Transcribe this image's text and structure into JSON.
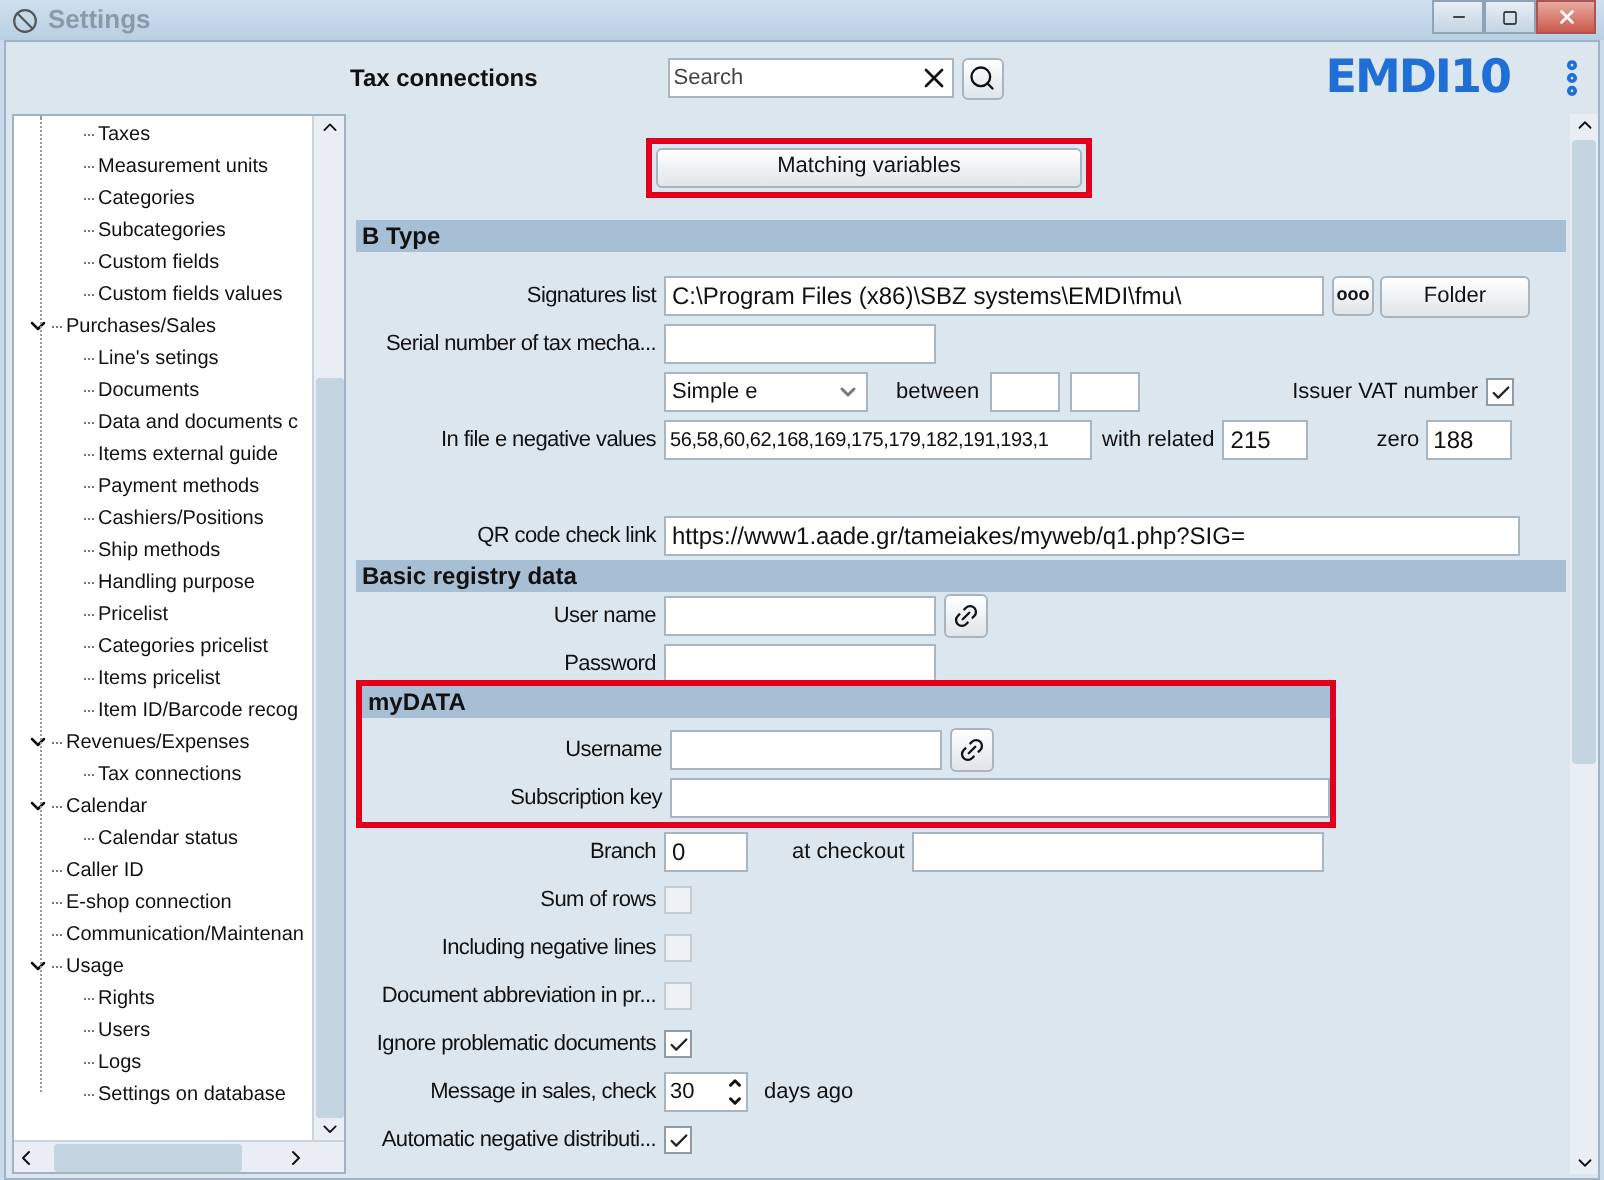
{
  "window": {
    "title": "Settings"
  },
  "header": {
    "title": "Tax connections",
    "search": {
      "placeholder": "Search"
    },
    "logo": "EMDI10"
  },
  "tree": [
    {
      "children": [
        {
          "label": "Taxes"
        },
        {
          "label": "Measurement units"
        },
        {
          "label": "Categories"
        },
        {
          "label": "Subcategories"
        },
        {
          "label": "Custom fields"
        },
        {
          "label": "Custom fields values"
        }
      ]
    },
    {
      "label": "Purchases/Sales",
      "expanded": true,
      "children": [
        {
          "label": "Line's setings"
        },
        {
          "label": "Documents"
        },
        {
          "label": "Data and documents c"
        },
        {
          "label": "Items external guide"
        },
        {
          "label": "Payment methods"
        },
        {
          "label": "Cashiers/Positions"
        },
        {
          "label": "Ship methods"
        },
        {
          "label": "Handling purpose"
        },
        {
          "label": "Pricelist"
        },
        {
          "label": "Categories pricelist"
        },
        {
          "label": "Items pricelist"
        },
        {
          "label": "Item ID/Barcode recog"
        }
      ]
    },
    {
      "label": "Revenues/Expenses",
      "expanded": true,
      "children": [
        {
          "label": "Tax connections"
        }
      ]
    },
    {
      "label": "Calendar",
      "expanded": true,
      "children": [
        {
          "label": "Calendar status"
        }
      ]
    },
    {
      "label": "Caller ID"
    },
    {
      "label": "E-shop connection"
    },
    {
      "label": "Communication/Maintenan"
    },
    {
      "label": "Usage",
      "expanded": true,
      "children": [
        {
          "label": "Rights"
        },
        {
          "label": "Users"
        },
        {
          "label": "Logs"
        },
        {
          "label": "Settings on database"
        }
      ]
    }
  ],
  "matching_button": {
    "label": "Matching variables",
    "highlighted": true
  },
  "b_type": {
    "title": "B Type",
    "signatures_list": {
      "label": "Signatures list",
      "value": "C:\\Program Files (x86)\\SBZ systems\\EMDI\\fmu\\",
      "browse": "ooo",
      "folder": "Folder"
    },
    "serial": {
      "label": "Serial number of tax mecha..."
    },
    "type_select": {
      "value": "Simple e",
      "between": "between"
    },
    "issuer_vat": {
      "label": "Issuer VAT number",
      "checked": true
    },
    "negative": {
      "label": "In file e negative values",
      "value": "56,58,60,62,168,169,175,179,182,191,193,1",
      "with_related_label": "with related",
      "with_related": "215",
      "zero_label": "zero",
      "zero": "188"
    },
    "qr": {
      "label": "QR code check link",
      "value": "https://www1.aade.gr/tameiakes/myweb/q1.php?SIG="
    }
  },
  "basic": {
    "title": "Basic registry data",
    "user_name": "User name",
    "password": "Password"
  },
  "mydata": {
    "title": "myDATA",
    "highlighted": true,
    "username": "Username",
    "subscription_key": "Subscription key"
  },
  "branch": {
    "label": "Branch",
    "value": "0",
    "at_checkout": "at checkout"
  },
  "options": [
    {
      "kind": "checkbox",
      "label": "Sum of rows",
      "checked": false
    },
    {
      "kind": "checkbox",
      "label": "Including negative lines",
      "checked": false
    },
    {
      "kind": "checkbox",
      "label": "Document abbreviation in pr...",
      "checked": false
    },
    {
      "kind": "checkbox",
      "label": "Ignore problematic documents",
      "checked": true
    },
    {
      "kind": "spinner",
      "label": "Message in sales, check",
      "value": "30",
      "suffix": "days ago"
    },
    {
      "kind": "checkbox",
      "label": "Automatic negative distributi...",
      "checked": true
    }
  ]
}
